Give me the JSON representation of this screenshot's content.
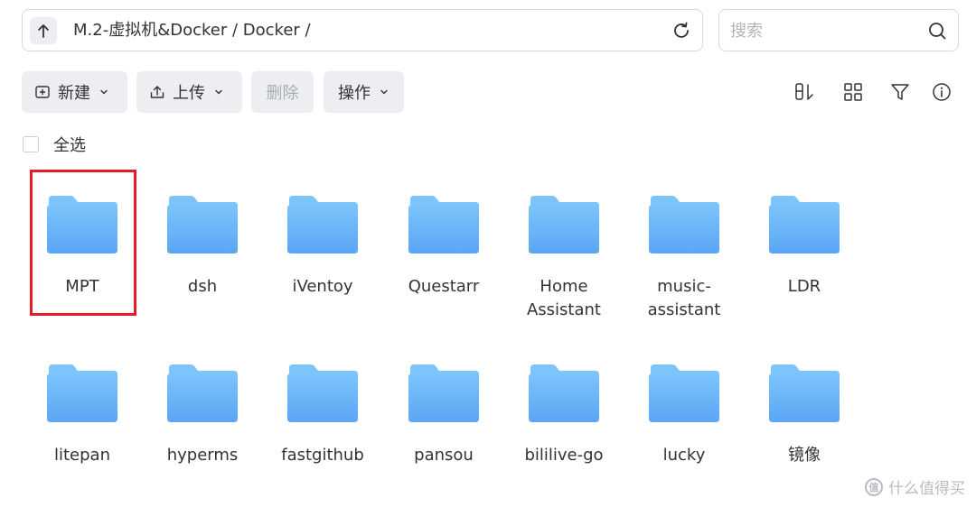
{
  "path": {
    "text": "M.2-虚拟机&Docker / Docker /"
  },
  "search": {
    "placeholder": "搜索"
  },
  "toolbar": {
    "new_label": "新建",
    "upload_label": "上传",
    "delete_label": "删除",
    "action_label": "操作"
  },
  "right_icons": [
    "sort-icon",
    "grid-view-icon",
    "filter-icon",
    "info-icon"
  ],
  "select_all_label": "全选",
  "folders": [
    {
      "name": "MPT"
    },
    {
      "name": "dsh"
    },
    {
      "name": "iVentoy"
    },
    {
      "name": "Questarr"
    },
    {
      "name": "Home Assistant"
    },
    {
      "name": "music-assistant"
    },
    {
      "name": "LDR"
    },
    {
      "name": "litepan"
    },
    {
      "name": "hyperms"
    },
    {
      "name": "fastgithub"
    },
    {
      "name": "pansou"
    },
    {
      "name": "bililive-go"
    },
    {
      "name": "lucky"
    },
    {
      "name": "镜像"
    }
  ],
  "watermark": "什么值得买",
  "colors": {
    "highlight": "#e31c2a",
    "folder_top": "#7cc4fa",
    "folder_bottom": "#5aa6f5",
    "button_bg": "#eceef1"
  }
}
